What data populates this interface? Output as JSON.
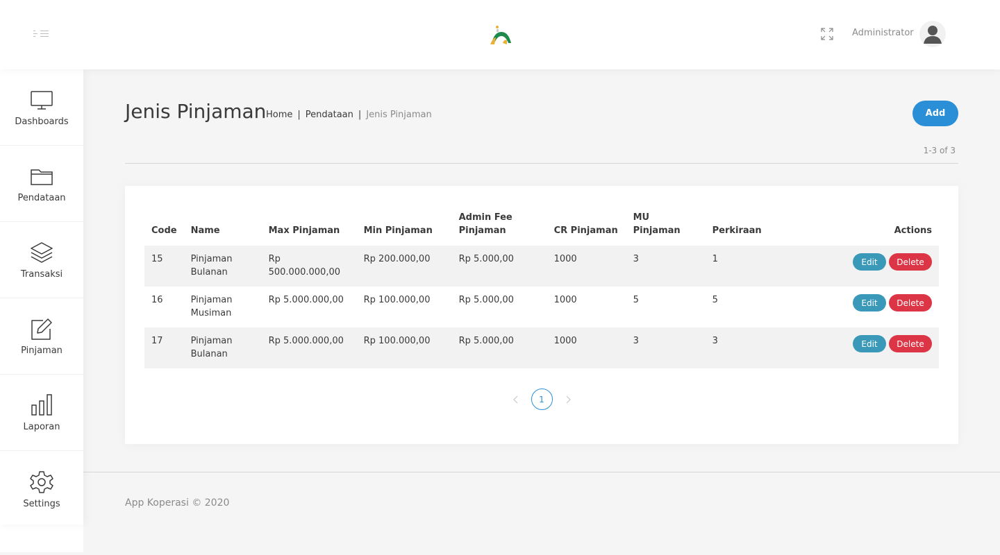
{
  "header": {
    "username": "Administrator"
  },
  "sidebar": {
    "items": [
      {
        "label": "Dashboards",
        "icon": "monitor-icon"
      },
      {
        "label": "Pendataan",
        "icon": "folder-icon"
      },
      {
        "label": "Transaksi",
        "icon": "layers-icon"
      },
      {
        "label": "Pinjaman",
        "icon": "edit-icon"
      },
      {
        "label": "Laporan",
        "icon": "bar-chart-icon"
      },
      {
        "label": "Settings",
        "icon": "gear-icon"
      }
    ]
  },
  "page": {
    "title": "Jenis Pinjaman",
    "breadcrumb": [
      "Home",
      "Pendataan",
      "Jenis Pinjaman"
    ],
    "add_label": "Add",
    "count": "1-3 of 3"
  },
  "table": {
    "columns": {
      "code": "Code",
      "name": "Name",
      "max": "Max Pinjaman",
      "min": "Min Pinjaman",
      "admin_fee": "Admin Fee Pinjaman",
      "cr": "CR Pinjaman",
      "mu": "MU Pinjaman",
      "perkiraan": "Perkiraan",
      "actions": "Actions"
    },
    "rows": [
      {
        "code": "15",
        "name": "Pinjaman Bulanan",
        "max": "Rp 500.000.000,00",
        "min": "Rp 200.000,00",
        "admin_fee": "Rp 5.000,00",
        "cr": "1000",
        "mu": "3",
        "perkiraan": "1"
      },
      {
        "code": "16",
        "name": "Pinjaman Musiman",
        "max": "Rp 5.000.000,00",
        "min": "Rp 100.000,00",
        "admin_fee": "Rp 5.000,00",
        "cr": "1000",
        "mu": "5",
        "perkiraan": "5"
      },
      {
        "code": "17",
        "name": "Pinjaman Bulanan",
        "max": "Rp 5.000.000,00",
        "min": "Rp 100.000,00",
        "admin_fee": "Rp 5.000,00",
        "cr": "1000",
        "mu": "3",
        "perkiraan": "3"
      }
    ],
    "edit_label": "Edit",
    "delete_label": "Delete"
  },
  "pagination": {
    "current_page": "1"
  },
  "footer": {
    "text": "App Koperasi © 2020"
  },
  "colors": {
    "primary": "#2a8fd6",
    "edit": "#3a98b9",
    "delete": "#dc3545"
  }
}
